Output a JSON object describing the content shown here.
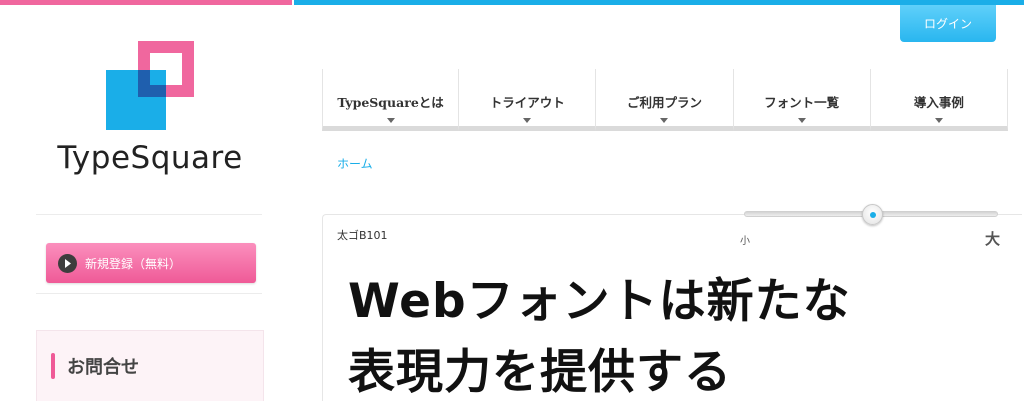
{
  "header": {
    "login_label": "ログイン",
    "accent_pink": "#f0679e",
    "accent_blue": "#1aaee8"
  },
  "sidebar": {
    "logo_text": "TypeSquare",
    "register_label": "新規登録（無料）",
    "contact_title": "お問合せ"
  },
  "nav": {
    "items": [
      {
        "label": "TypeSquareとは"
      },
      {
        "label": "トライアウト"
      },
      {
        "label": "ご利用プラン"
      },
      {
        "label": "フォント一覧"
      },
      {
        "label": "導入事例"
      }
    ]
  },
  "breadcrumb": {
    "home": "ホーム"
  },
  "sample": {
    "font_name": "太ゴB101",
    "size_min_label": "小",
    "size_max_label": "大",
    "size_level": 0.5,
    "text_line1": "Webフォントは新たな",
    "text_line2": "表現力を提供する"
  }
}
